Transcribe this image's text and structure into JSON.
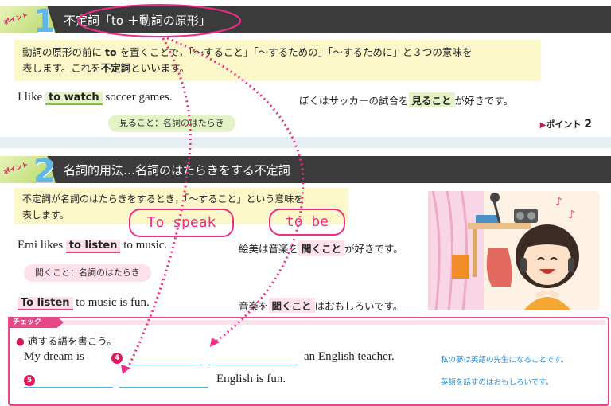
{
  "point1": {
    "badge": "ポイント",
    "number": "1",
    "title": "不定詞「to ＋動詞の原形」",
    "explain_line1_parts": [
      "動詞の原形の前に ",
      "to",
      " を置くことで，「～すること」「～するための」「～するために」と３つの意味を"
    ],
    "explain_line2_parts": [
      "表します。これを",
      "不定詞",
      "といいます。"
    ],
    "example_en": {
      "pre": "I like",
      "hl": "to  watch",
      "post": "soccer games."
    },
    "example_jp": {
      "pre": "ぼくはサッカーの試合を",
      "hl": "見ること",
      "post": "が好きです。"
    },
    "bubble": "見ること：名詞のはたらき",
    "next_link": "ポイント",
    "next_num": "2"
  },
  "point2": {
    "badge": "ポイント",
    "number": "2",
    "title": "名詞的用法…名詞のはたらきをする不定詞",
    "explain_line1": "不定詞が名詞のはたらきをするとき，「～すること」という意味を",
    "explain_line2": "表します。",
    "ex1_en": {
      "pre": "Emi likes",
      "hl": "to  listen",
      "post": "to music."
    },
    "ex1_jp": {
      "pre": "絵美は音楽を",
      "hl": "聞くこと",
      "post": "が好きです。"
    },
    "bubble": "聞くこと：名詞のはたらき",
    "ex2_en": {
      "hl": "To  listen",
      "post": "to music is fun."
    },
    "ex2_jp": {
      "pre": "音楽を",
      "hl": "聞くこと",
      "post": "はおもしろいです。"
    }
  },
  "check": {
    "tab": "チェック",
    "instruction": "適する語を書こう。",
    "q4": {
      "pre": "My dream is",
      "marker": "4",
      "post": "an English teacher.",
      "hint": "私の夢は英語の先生になることです。"
    },
    "q5": {
      "marker": "5",
      "post": "English is fun.",
      "hint": "英語を話すのはおもしろいです。"
    }
  },
  "annotations": {
    "to_speak": "To speak",
    "to_be": "to be"
  },
  "colors": {
    "pink": "#e44886",
    "green": "#7bbf3b",
    "blue": "#5aa9d6",
    "header": "#3b3b3b"
  }
}
